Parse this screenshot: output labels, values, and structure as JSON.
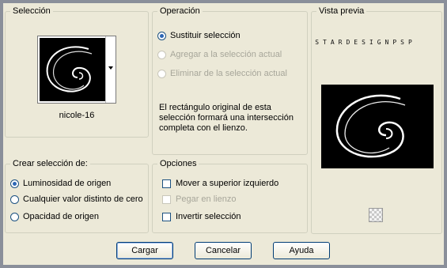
{
  "selection": {
    "title": "Selección",
    "image_name": "nicole-16"
  },
  "operation": {
    "title": "Operación",
    "options": [
      {
        "label": "Sustituir selección",
        "selected": true,
        "disabled": false
      },
      {
        "label": "Agregar a la selección actual",
        "selected": false,
        "disabled": true
      },
      {
        "label": "Eliminar de la selección actual",
        "selected": false,
        "disabled": true
      }
    ],
    "description": "El rectángulo original de esta selección formará una intersección completa con el lienzo."
  },
  "preview": {
    "title": "Vista previa",
    "brand_text": "STARDESIGNPSP",
    "transparency_icon": "checkerboard-icon"
  },
  "create_from": {
    "title": "Crear selección de:",
    "options": [
      {
        "label": "Luminosidad de origen",
        "selected": true
      },
      {
        "label": "Cualquier valor distinto de cero",
        "selected": false
      },
      {
        "label": "Opacidad de origen",
        "selected": false
      }
    ]
  },
  "options": {
    "title": "Opciones",
    "items": [
      {
        "label": "Mover a superior izquierdo",
        "checked": false,
        "disabled": false
      },
      {
        "label": "Pegar en lienzo",
        "checked": false,
        "disabled": true
      },
      {
        "label": "Invertir selección",
        "checked": false,
        "disabled": false
      }
    ]
  },
  "buttons": {
    "load": "Cargar",
    "cancel": "Cancelar",
    "help": "Ayuda"
  }
}
